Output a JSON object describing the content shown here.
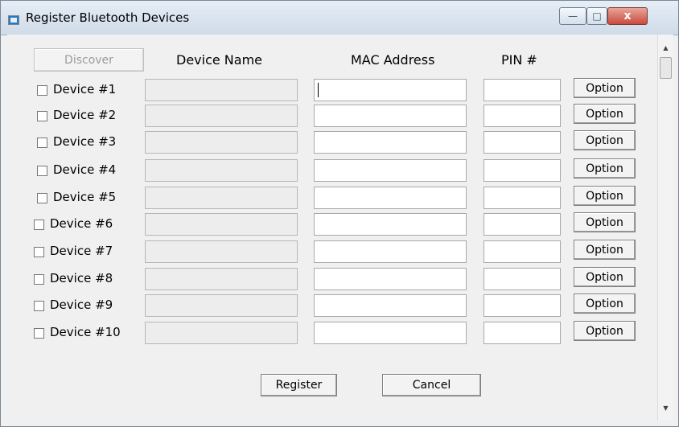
{
  "window": {
    "title": "Register Bluetooth Devices"
  },
  "titlebar_buttons": {
    "minimize": "—",
    "maximize": "□",
    "close": "x"
  },
  "headers": {
    "discover_label": "Discover",
    "device_name": "Device Name",
    "mac_address": "MAC Address",
    "pin": "PIN #"
  },
  "devices": [
    {
      "label": "Device #1",
      "option_label": "Option"
    },
    {
      "label": "Device #2",
      "option_label": "Option"
    },
    {
      "label": "Device #3",
      "option_label": "Option"
    },
    {
      "label": "Device #4",
      "option_label": "Option"
    },
    {
      "label": "Device #5",
      "option_label": "Option"
    },
    {
      "label": "Device #6",
      "option_label": "Option"
    },
    {
      "label": "Device #7",
      "option_label": "Option"
    },
    {
      "label": "Device #8",
      "option_label": "Option"
    },
    {
      "label": "Device #9",
      "option_label": "Option"
    },
    {
      "label": "Device #10",
      "option_label": "Option"
    }
  ],
  "footer": {
    "register_label": "Register",
    "cancel_label": "Cancel"
  },
  "scrollbar": {
    "up_icon": "▲",
    "down_icon": "▼"
  }
}
